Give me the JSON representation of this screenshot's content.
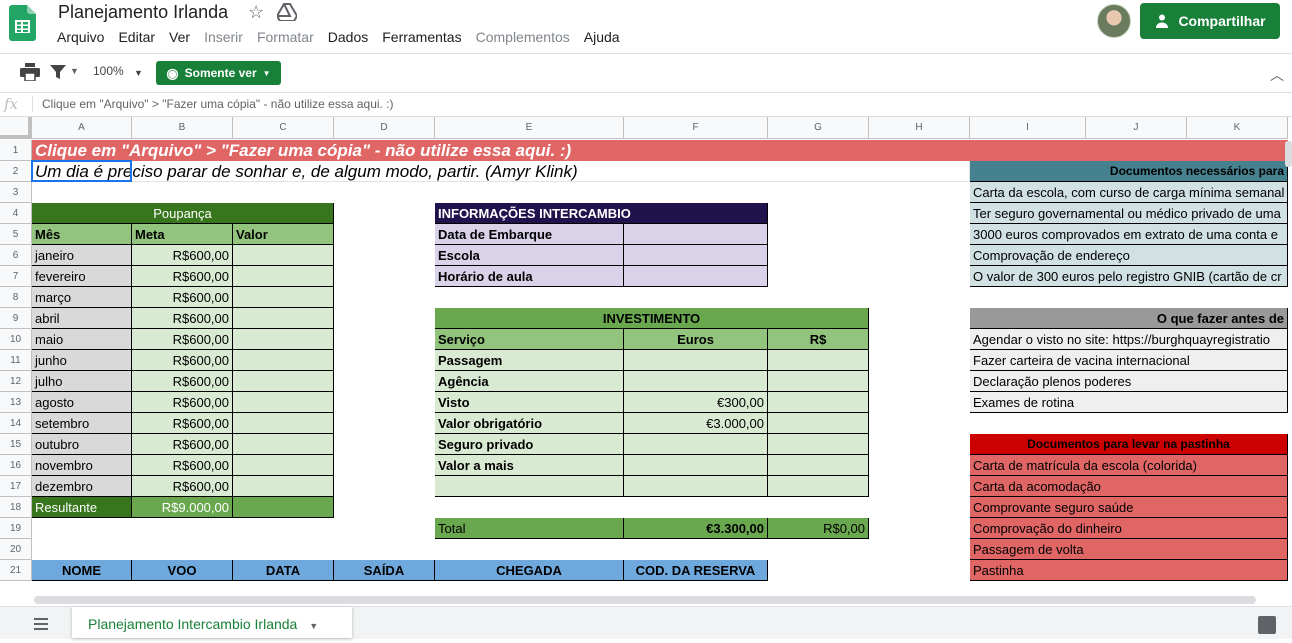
{
  "header": {
    "title": "Planejamento Irlanda",
    "menus": [
      {
        "label": "Arquivo",
        "enabled": true
      },
      {
        "label": "Editar",
        "enabled": true
      },
      {
        "label": "Ver",
        "enabled": true
      },
      {
        "label": "Inserir",
        "enabled": false
      },
      {
        "label": "Formatar",
        "enabled": false
      },
      {
        "label": "Dados",
        "enabled": true
      },
      {
        "label": "Ferramentas",
        "enabled": true
      },
      {
        "label": "Complementos",
        "enabled": false
      },
      {
        "label": "Ajuda",
        "enabled": true
      }
    ],
    "share_label": "Compartilhar"
  },
  "toolbar": {
    "zoom": "100%",
    "mode_label": "Somente ver"
  },
  "formula_bar": {
    "fx": "fx",
    "content": "Clique em \"Arquivo\" > \"Fazer uma cópia\" - não utilize essa aqui. :)"
  },
  "columns": [
    "A",
    "B",
    "C",
    "D",
    "E",
    "F",
    "G",
    "H",
    "I",
    "J",
    "K"
  ],
  "rows": [
    "1",
    "2",
    "3",
    "4",
    "5",
    "6",
    "7",
    "8",
    "9",
    "10",
    "11",
    "12",
    "13",
    "14",
    "15",
    "16",
    "17",
    "18",
    "19",
    "20",
    "21"
  ],
  "colors": {
    "brand_green": "#188038",
    "banner_red": "#e06666",
    "dark_green": "#38761d",
    "mid_green": "#6aa84f",
    "light_green": "#93c47d",
    "pale_green": "#d9ead3",
    "light_gray": "#d9d9d9",
    "navy": "#20124d",
    "lavender": "#d9d2e9",
    "teal": "#45818e",
    "pale_teal": "#d0e0e3",
    "gray_header": "#999999",
    "pale_gray": "#efefef",
    "red": "#cc0000",
    "blue": "#6fa8dc"
  },
  "sheet": {
    "banner": "Clique em \"Arquivo\" > \"Fazer uma cópia\" - não utilize essa aqui. :)",
    "quote": "Um dia é preciso parar de sonhar e, de algum modo, partir. (Amyr Klink)",
    "savings": {
      "title": "Poupança",
      "headers": [
        "Mês",
        "Meta",
        "Valor"
      ],
      "months": [
        "janeiro",
        "fevereiro",
        "março",
        "abril",
        "maio",
        "junho",
        "julho",
        "agosto",
        "setembro",
        "outubro",
        "novembro",
        "dezembro"
      ],
      "meta": "R$600,00",
      "total_label": "Resultante",
      "total_value": "R$9.000,00"
    },
    "exchange_info": {
      "title": "INFORMAÇÕES INTERCAMBIO",
      "rows": [
        "Data de Embarque",
        "Escola",
        "Horário de aula"
      ]
    },
    "investment": {
      "title": "INVESTIMENTO",
      "headers": [
        "Serviço",
        "Euros",
        "R$"
      ],
      "rows": [
        {
          "service": "Passagem",
          "euros": ""
        },
        {
          "service": "Agência",
          "euros": ""
        },
        {
          "service": "Visto",
          "euros": "€300,00"
        },
        {
          "service": "Valor obrigatório",
          "euros": "€3.000,00"
        },
        {
          "service": "Seguro privado",
          "euros": ""
        },
        {
          "service": "Valor a mais",
          "euros": ""
        },
        {
          "service": "",
          "euros": ""
        }
      ],
      "total_label": "Total",
      "total_euros": "€3.300,00",
      "total_brl": "R$0,00"
    },
    "docs_needed": {
      "title": "Documentos necessários para",
      "items": [
        "Carta da escola, com curso de carga mínima semanal",
        "Ter seguro governamental ou médico privado de uma",
        " 3000 euros comprovados em extrato de uma conta e",
        "Comprovação de endereço",
        "O valor de 300 euros pelo registro GNIB (cartão de cr"
      ]
    },
    "todo_before": {
      "title": "O que fazer antes de",
      "items": [
        "Agendar o visto no site: https://burghquayregistratio",
        "Fazer carteira de vacina internacional",
        "Declaração plenos poderes",
        "Exames de rotina"
      ]
    },
    "docs_folder": {
      "title": "Documentos para levar na pastinha",
      "items": [
        "Carta de matrícula da escola (colorida)",
        "Carta da acomodação",
        "Comprovante seguro saúde",
        "Comprovação do dinheiro",
        "Passagem de volta",
        "Pastinha"
      ]
    },
    "flights_headers": [
      "NOME",
      "VOO",
      "DATA",
      "SAÍDA",
      "CHEGADA",
      "COD. DA RESERVA"
    ]
  },
  "tabs": [
    {
      "label": "Planejamento Intercambio Irlanda",
      "active": true
    }
  ]
}
